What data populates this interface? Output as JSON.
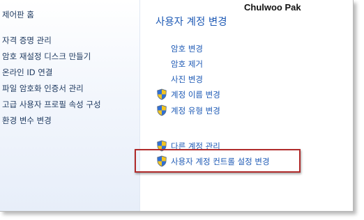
{
  "window": {
    "user_name": "Chulwoo Pak"
  },
  "sidebar": {
    "home_label": "제어판 홈",
    "items": [
      {
        "label": "자격 증명 관리"
      },
      {
        "label": "암호 재설정 디스크 만들기"
      },
      {
        "label": "온라인 ID 연결"
      },
      {
        "label": "파일 암호화 인증서 관리"
      },
      {
        "label": "고급 사용자 프로필 속성 구성"
      },
      {
        "label": "환경 변수 변경"
      }
    ]
  },
  "main": {
    "title": "사용자 계정 변경",
    "tasks": [
      {
        "label": "암호 변경",
        "icon": "none"
      },
      {
        "label": "암호 제거",
        "icon": "none"
      },
      {
        "label": "사진 변경",
        "icon": "none"
      },
      {
        "label": "계정 이름 변경",
        "icon": "uac-shield-icon"
      },
      {
        "label": "계정 유형 변경",
        "icon": "uac-shield-icon"
      }
    ],
    "other_tasks": [
      {
        "label": "다른 계정 관리",
        "icon": "uac-shield-icon"
      },
      {
        "label": "사용자 계정 컨트롤 설정 변경",
        "icon": "uac-shield-icon"
      }
    ]
  },
  "colors": {
    "link": "#1e5ab5",
    "sidebar_text": "#1f3a60",
    "highlight_border": "#b02a2a"
  }
}
